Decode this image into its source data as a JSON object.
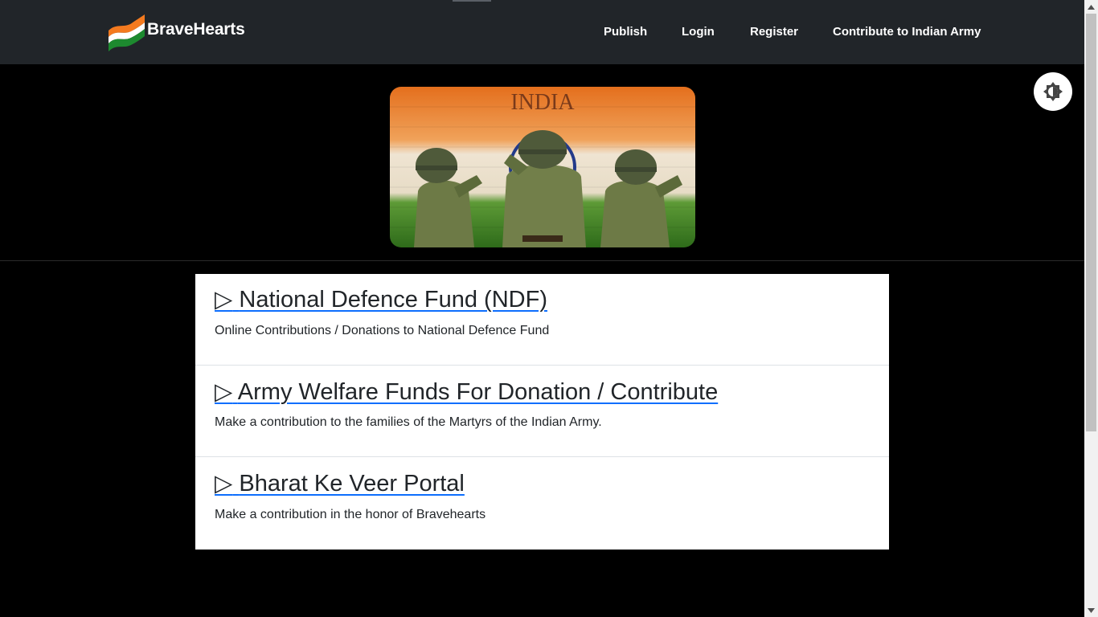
{
  "navbar": {
    "brand": "BraveHearts",
    "links": [
      "Publish",
      "Login",
      "Register",
      "Contribute to Indian Army"
    ]
  },
  "hero": {
    "banner_text": "INDIA"
  },
  "funds": [
    {
      "title": "National Defence Fund (NDF)",
      "description": "Online Contributions / Donations to National Defence Fund"
    },
    {
      "title": "Army Welfare Funds For Donation / Contribute",
      "description": "Make a contribution to the families of the Martyrs of the Indian Army."
    },
    {
      "title": "Bharat Ke Veer Portal",
      "description": "Make a contribution in the honor of Bravehearts"
    }
  ],
  "icons": {
    "fund_marker": "▷",
    "theme_toggle": "brightness-icon",
    "logo": "tricolor-flag-icon"
  },
  "colors": {
    "navbar_bg": "#212529",
    "page_bg": "#000000",
    "link_underline": "#0d6efd",
    "saffron": "#f47a1f",
    "green": "#1d8a2f"
  }
}
